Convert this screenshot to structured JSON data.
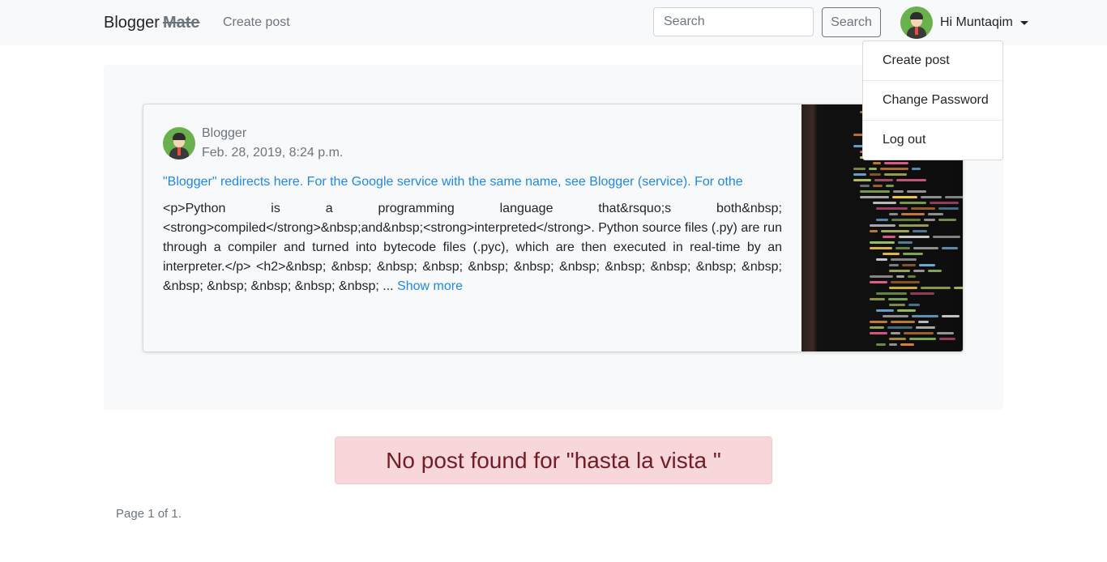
{
  "navbar": {
    "brand_name": "Blogger",
    "brand_suffix": "Mate",
    "create_post_link": "Create post",
    "search": {
      "placeholder": "Search",
      "value": ""
    },
    "search_button": "Search",
    "user_greeting": "Hi Muntaqim"
  },
  "dropdown": {
    "items": [
      {
        "label": "Create post"
      },
      {
        "label": "Change Password"
      },
      {
        "label": "Log out"
      }
    ]
  },
  "post": {
    "author": "Blogger",
    "date": "Feb. 28, 2019, 8:24 p.m.",
    "title": "\"Blogger\" redirects here. For the Google service with the same name, see Blogger (service). For othe",
    "excerpt": "<p>Python is a programming language that&rsquo;s both&nbsp; <strong>compiled</strong>&nbsp;and&nbsp;<strong>interpreted</strong>. Python source files (.py) are run through a compiler and turned into bytecode files (.pyc), which are then executed in real-time by an interpreter.</p> <h2>&nbsp; &nbsp; &nbsp; &nbsp; &nbsp; &nbsp; &nbsp; &nbsp; &nbsp; &nbsp; &nbsp; &nbsp; &nbsp; &nbsp; &nbsp; &nbsp; ...",
    "show_more": "Show more"
  },
  "alert": {
    "message": "No post found for \"hasta la vista \""
  },
  "pagination": {
    "text": "Page 1 of 1."
  },
  "colors": {
    "link": "#1e88e5",
    "alert_bg": "#f8d7da",
    "alert_text": "#721c24",
    "navbar_bg": "#f8f9fa"
  },
  "icons": [
    "user-avatar-icon",
    "caret-down-icon",
    "code-screen-image"
  ]
}
